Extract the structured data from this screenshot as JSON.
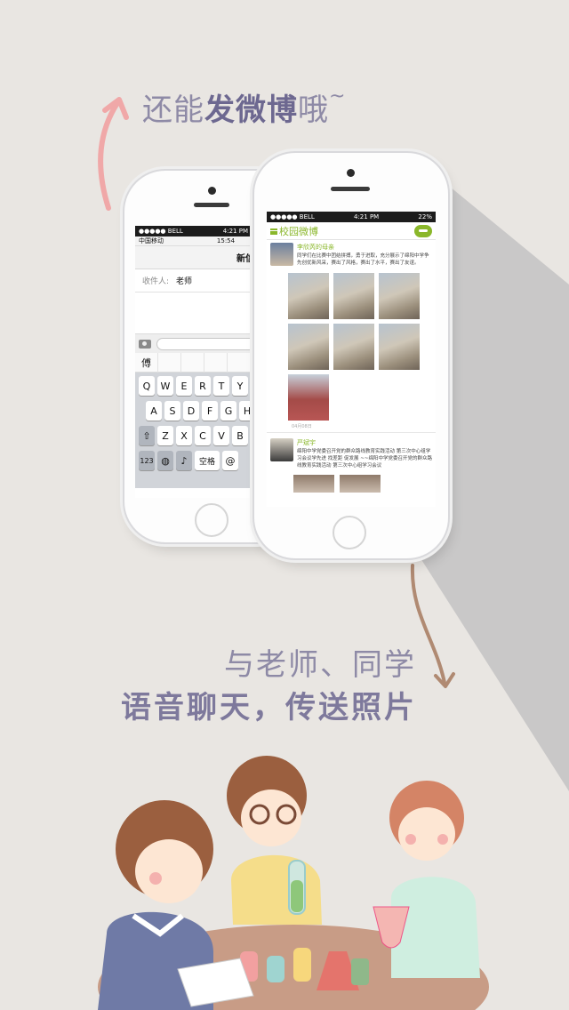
{
  "headline_top": {
    "prefix": "还能",
    "emphasis": "发微博",
    "suffix": "哦",
    "tilde": "~"
  },
  "headline_bottom": {
    "line1": "与老师、同学",
    "line2": "语音聊天，传送照片"
  },
  "sms_phone": {
    "status": {
      "carrier": "●●●●● BELL",
      "time": "4:21 PM"
    },
    "status_inner": {
      "carrier": "中国移动",
      "time": "15:54"
    },
    "title": "新信息",
    "recipient_label": "收件人:",
    "recipient_value": "老师",
    "candidate": "傅",
    "keyboard": {
      "row1": [
        "Q",
        "W",
        "E",
        "R",
        "T",
        "Y",
        "U"
      ],
      "row2": [
        "A",
        "S",
        "D",
        "F",
        "G",
        "H"
      ],
      "row3": [
        "Z",
        "X",
        "C",
        "V",
        "B"
      ],
      "bottom": [
        "123",
        "空格",
        "@"
      ]
    }
  },
  "weibo_phone": {
    "status": {
      "carrier": "●●●●● BELL",
      "time": "4:21 PM",
      "battery": "22%"
    },
    "app_title": "校园微博",
    "post1": {
      "author": "李欣芮的母亲",
      "text": "同学们在比赛中团结拼搏，勇于进取，充分展示了绵阳中学争先创优新风采，赛出了风格，赛出了水平，赛出了友谊。",
      "date": "04月08日"
    },
    "post2": {
      "author": "严斌宇",
      "text": "绵阳中学党委召开党的群众路线教育实践活动 第三次中心组学习会议学先进 找差距 促发展 ~~绵阳中学党委召开党的群众路线教育实践活动 第三次中心组学习会议"
    }
  }
}
